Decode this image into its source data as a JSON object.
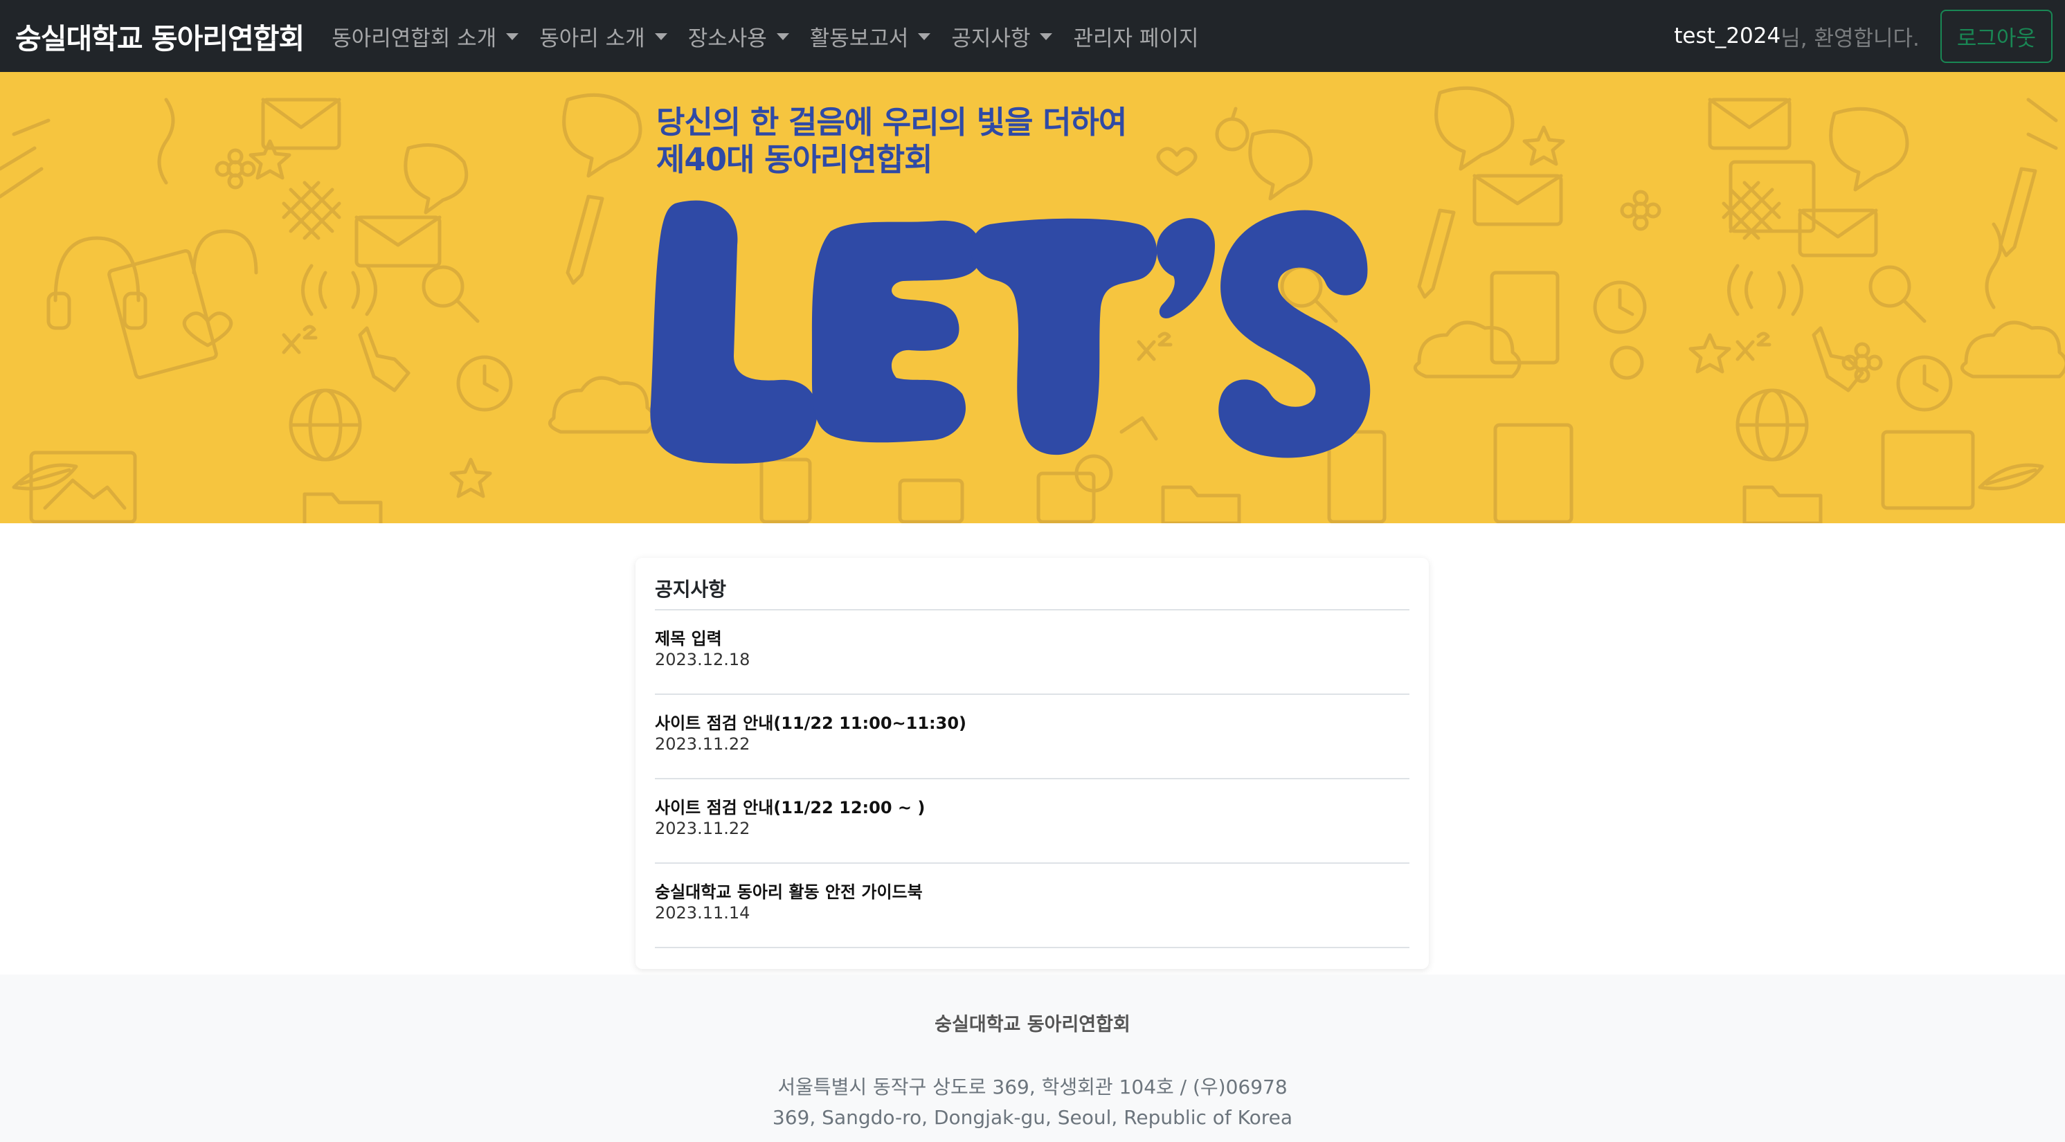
{
  "navbar": {
    "brand": "숭실대학교 동아리연합회",
    "menu": [
      {
        "label": "동아리연합회 소개",
        "dropdown": true
      },
      {
        "label": "동아리 소개",
        "dropdown": true
      },
      {
        "label": "장소사용",
        "dropdown": true
      },
      {
        "label": "활동보고서",
        "dropdown": true
      },
      {
        "label": "공지사항",
        "dropdown": true
      },
      {
        "label": "관리자 페이지",
        "dropdown": false
      }
    ],
    "user_name": "test_2024",
    "welcome_text": "님, 환영합니다.",
    "logout_label": "로그아웃"
  },
  "banner": {
    "tagline_line1": "당신의 한 걸음에 우리의 빛을 더하여",
    "tagline_line2": "제40대 동아리연합회",
    "logo_text": "LET'S",
    "background_color": "#f6c53f",
    "text_color": "#2f4aa6"
  },
  "notices": {
    "title": "공지사항",
    "items": [
      {
        "title": "제목 입력",
        "date": "2023.12.18"
      },
      {
        "title": "사이트 점검 안내(11/22 11:00~11:30)",
        "date": "2023.11.22"
      },
      {
        "title": "사이트 점검 안내(11/22 12:00 ~ )",
        "date": "2023.11.22"
      },
      {
        "title": "숭실대학교 동아리 활동 안전 가이드북",
        "date": "2023.11.14"
      }
    ]
  },
  "footer": {
    "org_name": "숭실대학교 동아리연합회",
    "address_ko": "서울특별시 동작구 상도로 369, 학생회관 104호 / (우)06978",
    "address_en": "369, Sangdo-ro, Dongjak-gu, Seoul, Republic of Korea"
  }
}
